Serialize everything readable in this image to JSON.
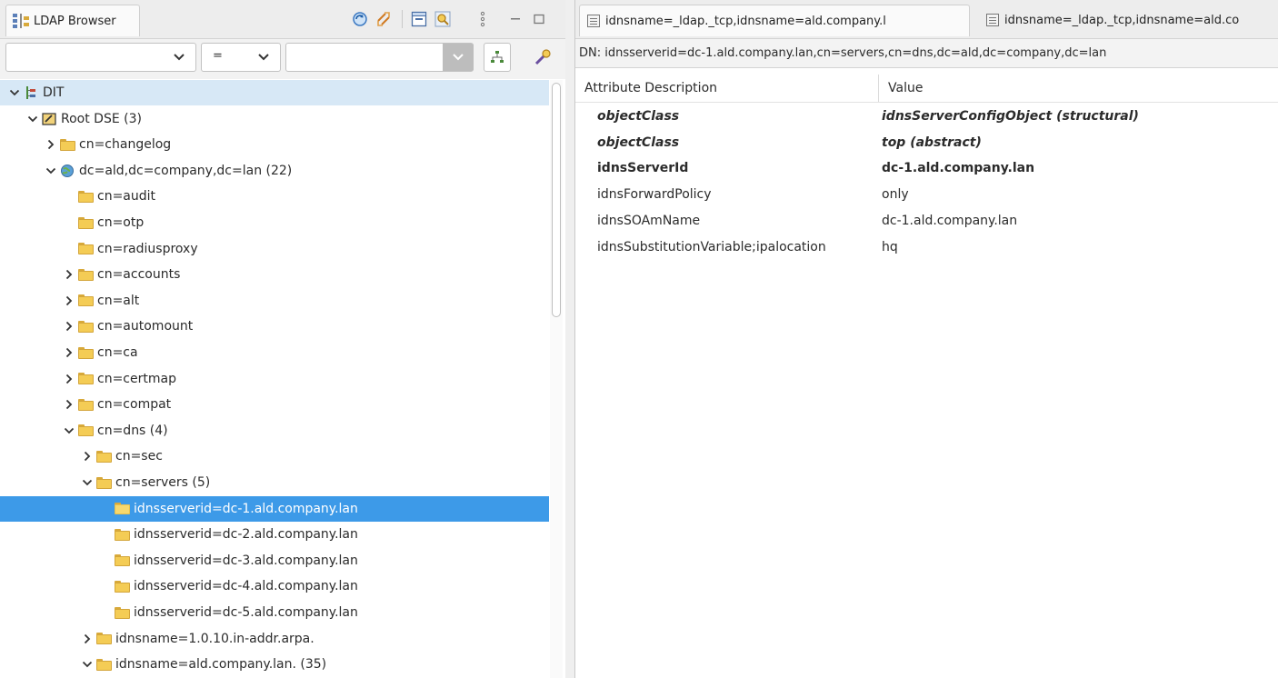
{
  "browser": {
    "tab_title": "LDAP Browser",
    "tree": [
      {
        "label": "DIT",
        "level": 0,
        "expander": "open",
        "icon": "dit-icon"
      },
      {
        "label": "Root DSE (3)",
        "level": 1,
        "expander": "open",
        "icon": "root-dse-icon"
      },
      {
        "label": "cn=changelog",
        "level": 2,
        "expander": "closed",
        "icon": "folder-icon"
      },
      {
        "label": "dc=ald,dc=company,dc=lan (22)",
        "level": 2,
        "expander": "open",
        "icon": "globe-icon"
      },
      {
        "label": "cn=audit",
        "level": 3,
        "expander": "none",
        "icon": "folder-icon"
      },
      {
        "label": "cn=otp",
        "level": 3,
        "expander": "none",
        "icon": "folder-icon"
      },
      {
        "label": "cn=radiusproxy",
        "level": 3,
        "expander": "none",
        "icon": "folder-icon"
      },
      {
        "label": "cn=accounts",
        "level": 3,
        "expander": "closed",
        "icon": "folder-icon"
      },
      {
        "label": "cn=alt",
        "level": 3,
        "expander": "closed",
        "icon": "folder-icon"
      },
      {
        "label": "cn=automount",
        "level": 3,
        "expander": "closed",
        "icon": "folder-icon"
      },
      {
        "label": "cn=ca",
        "level": 3,
        "expander": "closed",
        "icon": "folder-icon"
      },
      {
        "label": "cn=certmap",
        "level": 3,
        "expander": "closed",
        "icon": "folder-icon"
      },
      {
        "label": "cn=compat",
        "level": 3,
        "expander": "closed",
        "icon": "folder-icon"
      },
      {
        "label": "cn=dns (4)",
        "level": 3,
        "expander": "open",
        "icon": "folder-icon"
      },
      {
        "label": "cn=sec",
        "level": 4,
        "expander": "closed",
        "icon": "folder-icon"
      },
      {
        "label": "cn=servers (5)",
        "level": 4,
        "expander": "open",
        "icon": "folder-icon"
      },
      {
        "label": "idnsserverid=dc-1.ald.company.lan",
        "level": 5,
        "expander": "none",
        "icon": "folder-icon",
        "selected": true
      },
      {
        "label": "idnsserverid=dc-2.ald.company.lan",
        "level": 5,
        "expander": "none",
        "icon": "folder-icon"
      },
      {
        "label": "idnsserverid=dc-3.ald.company.lan",
        "level": 5,
        "expander": "none",
        "icon": "folder-icon"
      },
      {
        "label": "idnsserverid=dc-4.ald.company.lan",
        "level": 5,
        "expander": "none",
        "icon": "folder-icon"
      },
      {
        "label": "idnsserverid=dc-5.ald.company.lan",
        "level": 5,
        "expander": "none",
        "icon": "folder-icon"
      },
      {
        "label": "idnsname=1.0.10.in-addr.arpa.",
        "level": 4,
        "expander": "closed",
        "icon": "folder-icon"
      },
      {
        "label": "idnsname=ald.company.lan. (35)",
        "level": 4,
        "expander": "open",
        "icon": "folder-icon"
      }
    ],
    "filter": {
      "operator": "="
    }
  },
  "editor": {
    "tabs": [
      {
        "label": "idnsname=_ldap._tcp,idnsname=ald.company.l",
        "active": true
      },
      {
        "label": "idnsname=_ldap._tcp,idnsname=ald.co",
        "active": false
      }
    ],
    "dn": "DN: idnsserverid=dc-1.ald.company.lan,cn=servers,cn=dns,dc=ald,dc=company,dc=lan",
    "columns": {
      "attribute": "Attribute Description",
      "value": "Value"
    },
    "attributes": [
      {
        "name": "objectClass",
        "value": "idnsServerConfigObject (structural)",
        "kind": "objectclass"
      },
      {
        "name": "objectClass",
        "value": "top (abstract)",
        "kind": "objectclass"
      },
      {
        "name": "idnsServerId",
        "value": "dc-1.ald.company.lan",
        "kind": "must"
      },
      {
        "name": "idnsForwardPolicy",
        "value": "only",
        "kind": "may"
      },
      {
        "name": "idnsSOAmName",
        "value": "dc-1.ald.company.lan",
        "kind": "may"
      },
      {
        "name": "idnsSubstitutionVariable;ipalocation",
        "value": "hq",
        "kind": "may"
      }
    ]
  },
  "colors": {
    "selection": "#3d9ae8",
    "dit_row": "#d7e8f6",
    "folder": "#f4cc55"
  }
}
